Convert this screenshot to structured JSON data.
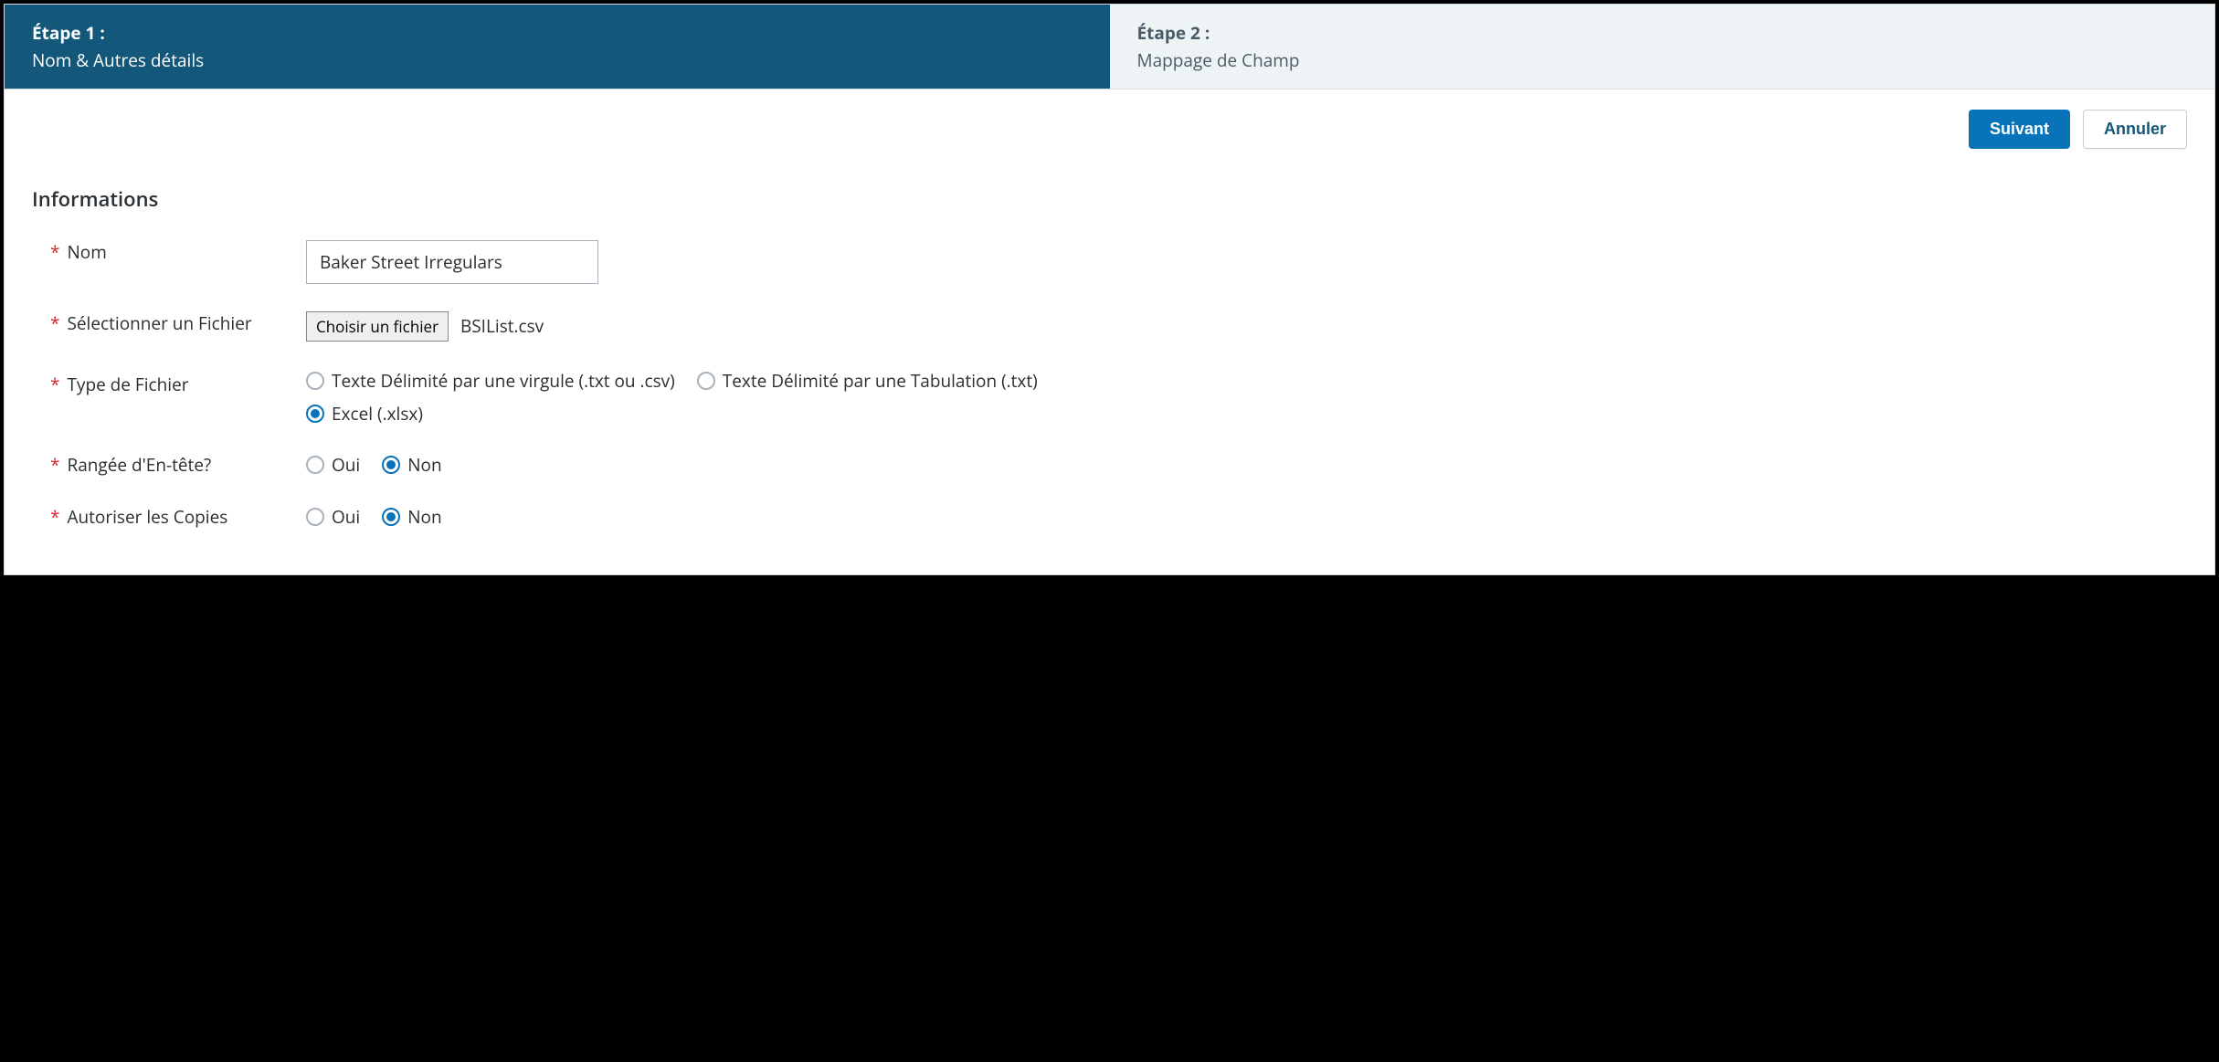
{
  "steps": {
    "step1": {
      "title": "Étape 1 :",
      "subtitle": "Nom & Autres détails"
    },
    "step2": {
      "title": "Étape 2 :",
      "subtitle": "Mappage de Champ"
    }
  },
  "actions": {
    "next": "Suivant",
    "cancel": "Annuler"
  },
  "section": {
    "title": "Informations"
  },
  "form": {
    "required_marker": "*",
    "name": {
      "label": "Nom",
      "value": "Baker Street Irregulars"
    },
    "file": {
      "label": "Sélectionner un Fichier",
      "button": "Choisir un fichier",
      "filename": "BSIList.csv"
    },
    "filetype": {
      "label": "Type de Fichier",
      "options": {
        "csv": "Texte Délimité par une virgule (.txt ou .csv)",
        "tab": "Texte Délimité par une Tabulation (.txt)",
        "excel": "Excel (.xlsx)"
      }
    },
    "header": {
      "label": "Rangée d'En-tête?",
      "options": {
        "yes": "Oui",
        "no": "Non"
      }
    },
    "duplicates": {
      "label": "Autoriser les Copies",
      "options": {
        "yes": "Oui",
        "no": "Non"
      }
    }
  }
}
